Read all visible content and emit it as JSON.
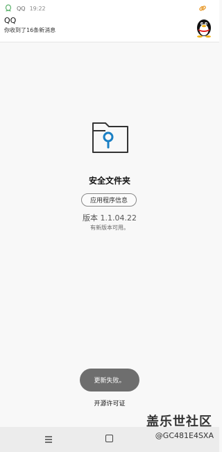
{
  "notification": {
    "app_name": "QQ",
    "time": "19:22",
    "title": "QQ",
    "text": "你收到了16条新消息",
    "app_icon": "qq-app-icon",
    "link_icon": "link-icon",
    "avatar_icon": "qq-penguin-avatar"
  },
  "app": {
    "icon": "secure-folder-icon",
    "title": "安全文件夹",
    "info_button": "应用程序信息",
    "version": "版本 1.1.04.22",
    "update_note": "有新版本可用。",
    "license_link": "开源许可证"
  },
  "toast": {
    "text": "更新失败。"
  },
  "navbar": {
    "recent_icon": "recent-apps-icon",
    "home_icon": "home-icon"
  },
  "watermark": {
    "title": "盖乐世社区",
    "user": "@GC481E4SXA"
  },
  "colors": {
    "background": "#f8f8f8",
    "accent": "#1a7fc4",
    "toast_bg": "#6e6e6e",
    "link_icon": "#e89a2c"
  }
}
